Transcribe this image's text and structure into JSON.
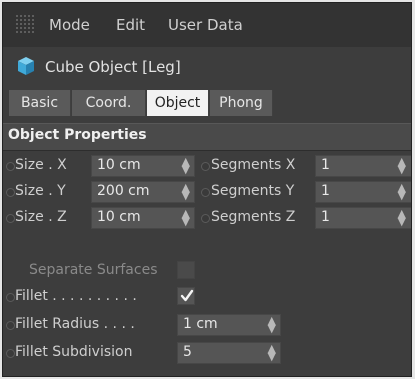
{
  "menu": {
    "mode": "Mode",
    "edit": "Edit",
    "user_data": "User Data"
  },
  "object_title": "Cube Object [Leg]",
  "tabs": [
    "Basic",
    "Coord.",
    "Object",
    "Phong"
  ],
  "active_tab": "Object",
  "section": "Object Properties",
  "size": [
    {
      "label": "Size . X",
      "value": "10 cm"
    },
    {
      "label": "Size . Y",
      "value": "200 cm"
    },
    {
      "label": "Size . Z",
      "value": "10 cm"
    }
  ],
  "segments": [
    {
      "label": "Segments X",
      "value": "1"
    },
    {
      "label": "Segments Y",
      "value": "1"
    },
    {
      "label": "Segments Z",
      "value": "1"
    }
  ],
  "separate_surfaces": {
    "label": "Separate Surfaces",
    "checked": false
  },
  "fillet": {
    "label": "Fillet . . . . . . . . . .",
    "checked": true
  },
  "fillet_radius": {
    "label": "Fillet Radius . . . .",
    "value": "1 cm"
  },
  "fillet_subdivision": {
    "label": "Fillet Subdivision",
    "value": "5"
  },
  "colors": {
    "active_tab": "#f2f2f2",
    "panel": "#3d3d3d",
    "field": "#555555",
    "cube_icon": "#3fa9d8"
  }
}
